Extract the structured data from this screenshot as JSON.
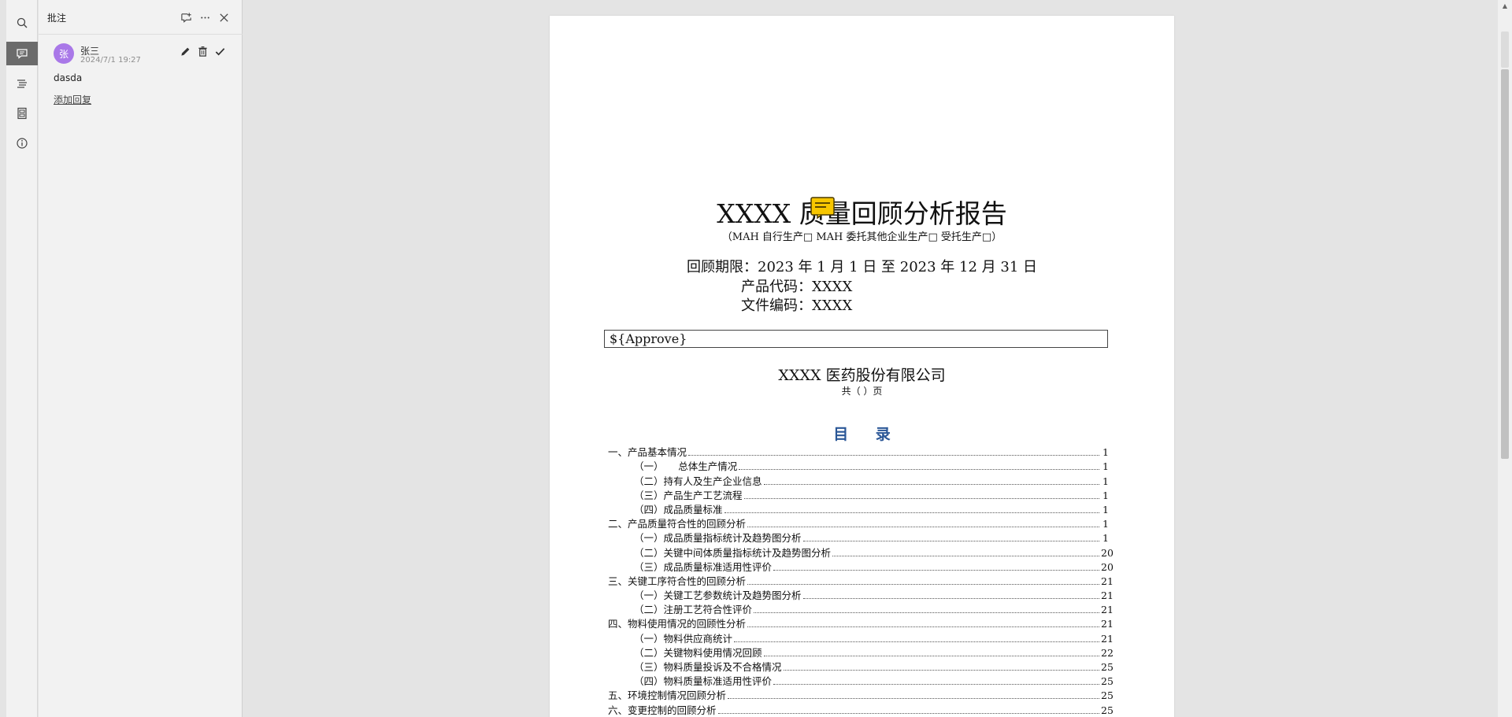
{
  "rail": {
    "items": [
      {
        "icon": "search-icon",
        "active": false
      },
      {
        "icon": "comment-icon",
        "active": true
      },
      {
        "icon": "outline-icon",
        "active": false
      },
      {
        "icon": "thumbnail-icon",
        "active": false
      },
      {
        "icon": "info-icon",
        "active": false
      }
    ]
  },
  "panel": {
    "title": "批注",
    "comment": {
      "avatar": "张",
      "author": "张三",
      "time": "2024/7/1 19:27",
      "body": "dasda",
      "reply_label": "添加回复"
    }
  },
  "document": {
    "title": "XXXX 质量回顾分析报告",
    "subtitle": "（MAH 自行生产□ MAH 委托其他企业生产□ 受托生产□）",
    "period": "回顾期限：2023 年 1 月 1 日 至 2023 年 12 月 31 日",
    "product_code": "产品代码：XXXX",
    "doc_code": "文件编码：XXXX",
    "approve": "${Approve}",
    "company": "XXXX 医药股份有限公司",
    "page_count": "共（ ）页",
    "toc_heading": "目 录",
    "toc": [
      {
        "text": "一、产品基本情况",
        "page": "1",
        "level": 1
      },
      {
        "text": "（一）　　总体生产情况",
        "page": "1",
        "level": 2
      },
      {
        "text": "（二）持有人及生产企业信息",
        "page": "1",
        "level": 2
      },
      {
        "text": "（三）产品生产工艺流程",
        "page": "1",
        "level": 2
      },
      {
        "text": "（四）成品质量标准",
        "page": "1",
        "level": 2
      },
      {
        "text": "二、产品质量符合性的回顾分析",
        "page": "1",
        "level": 1
      },
      {
        "text": "（一）成品质量指标统计及趋势图分析",
        "page": "1",
        "level": 2
      },
      {
        "text": "（二）关键中间体质量指标统计及趋势图分析",
        "page": "20",
        "level": 2
      },
      {
        "text": "（三）成品质量标准适用性评价",
        "page": "20",
        "level": 2
      },
      {
        "text": "三、关键工序符合性的回顾分析",
        "page": "21",
        "level": 1
      },
      {
        "text": "（一）关键工艺参数统计及趋势图分析",
        "page": "21",
        "level": 2
      },
      {
        "text": "（二）注册工艺符合性评价",
        "page": "21",
        "level": 2
      },
      {
        "text": "四、物料使用情况的回顾性分析",
        "page": "21",
        "level": 1
      },
      {
        "text": "（一）物料供应商统计",
        "page": "21",
        "level": 2
      },
      {
        "text": "（二）关键物料使用情况回顾",
        "page": "22",
        "level": 2
      },
      {
        "text": "（三）物料质量投诉及不合格情况",
        "page": "25",
        "level": 2
      },
      {
        "text": "（四）物料质量标准适用性评价",
        "page": "25",
        "level": 2
      },
      {
        "text": "五、环境控制情况回顾分析",
        "page": "25",
        "level": 1
      },
      {
        "text": "六、变更控制的回顾分析",
        "page": "25",
        "level": 1
      }
    ]
  }
}
